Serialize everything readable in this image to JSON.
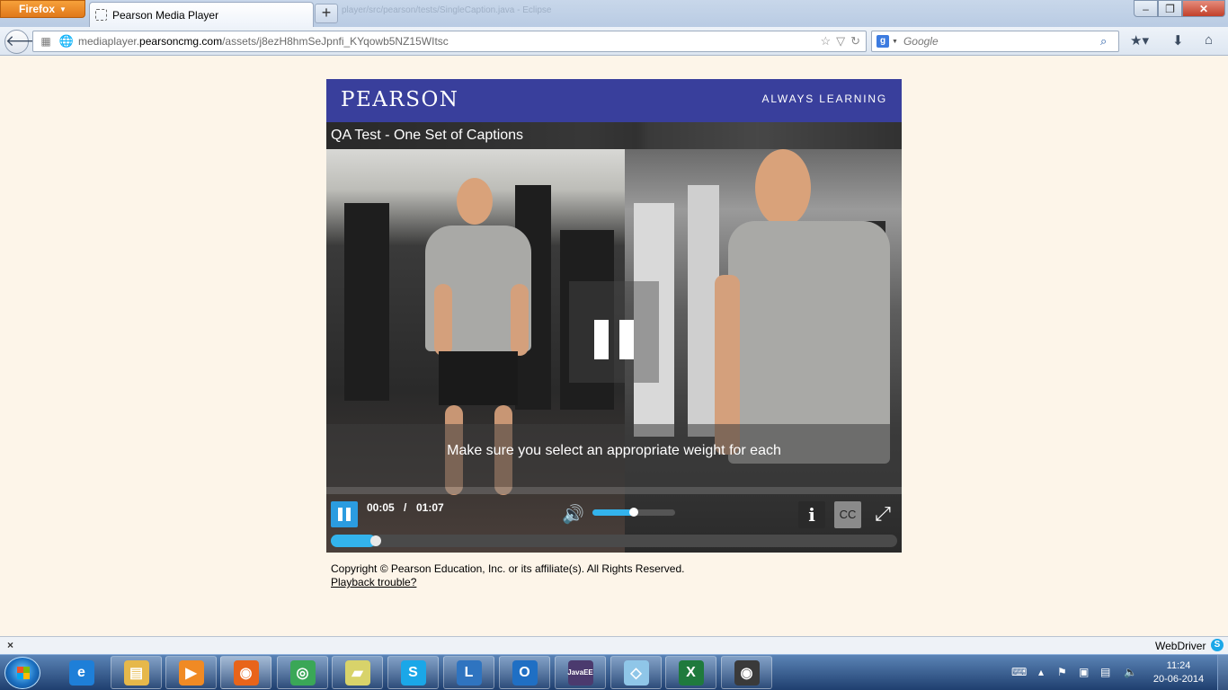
{
  "browser": {
    "menu_label": "Firefox",
    "tab_title": "Pearson Media Player",
    "new_tab": "+",
    "ghost_title": "player/src/pearson/tests/SingleCaption.java - Eclipse",
    "url_gray": "mediaplayer.",
    "url_host": "pearsoncmg.com",
    "url_path": "/assets/j8ezH8hmSeJpnfi_KYqowb5NZ15WItsc",
    "search_placeholder": "Google",
    "window_controls": {
      "minimize": "–",
      "maximize": "❐",
      "close": "✕"
    }
  },
  "player": {
    "brand_logo": "PEARSON",
    "brand_tagline": "ALWAYS LEARNING",
    "video_title": "QA Test - One Set of Captions",
    "caption": "Make sure you select an appropriate weight for each",
    "current_time": "00:05",
    "time_separator": "/",
    "duration": "01:07",
    "volume_level": 0.5,
    "progress": 0.08,
    "info_label": "i",
    "cc_label": "CC",
    "fullscreen_label": "⤢"
  },
  "footer": {
    "copyright": "Copyright © Pearson Education, Inc. or its affiliate(s). All Rights Reserved.",
    "trouble_link": "Playback trouble?"
  },
  "addon_bar": {
    "close": "×",
    "webdriver_label": "WebDriver",
    "skype_badge": "S"
  },
  "taskbar": {
    "apps": [
      {
        "name": "internet-explorer",
        "glyph": "e",
        "color": "#1e7fd8"
      },
      {
        "name": "file-explorer",
        "glyph": "▤",
        "color": "#e6b84a"
      },
      {
        "name": "media-player",
        "glyph": "▶",
        "color": "#f08a24"
      },
      {
        "name": "firefox",
        "glyph": "◉",
        "color": "#e8641a"
      },
      {
        "name": "chrome",
        "glyph": "◎",
        "color": "#3aa757"
      },
      {
        "name": "sticky-notes",
        "glyph": "▰",
        "color": "#d8d36a"
      },
      {
        "name": "skype",
        "glyph": "S",
        "color": "#1aa7e8"
      },
      {
        "name": "lync",
        "glyph": "L",
        "color": "#2f74c0"
      },
      {
        "name": "outlook",
        "glyph": "O",
        "color": "#1f6fc4"
      },
      {
        "name": "eclipse-java-ee",
        "glyph": "JavaEE",
        "color": "#4b3a6e"
      },
      {
        "name": "file-manager",
        "glyph": "◇",
        "color": "#8fc6e8"
      },
      {
        "name": "excel",
        "glyph": "X",
        "color": "#1f7a3d"
      },
      {
        "name": "camera",
        "glyph": "◉",
        "color": "#3a3a3a"
      }
    ],
    "clock_time": "11:24",
    "clock_date": "20-06-2014"
  }
}
